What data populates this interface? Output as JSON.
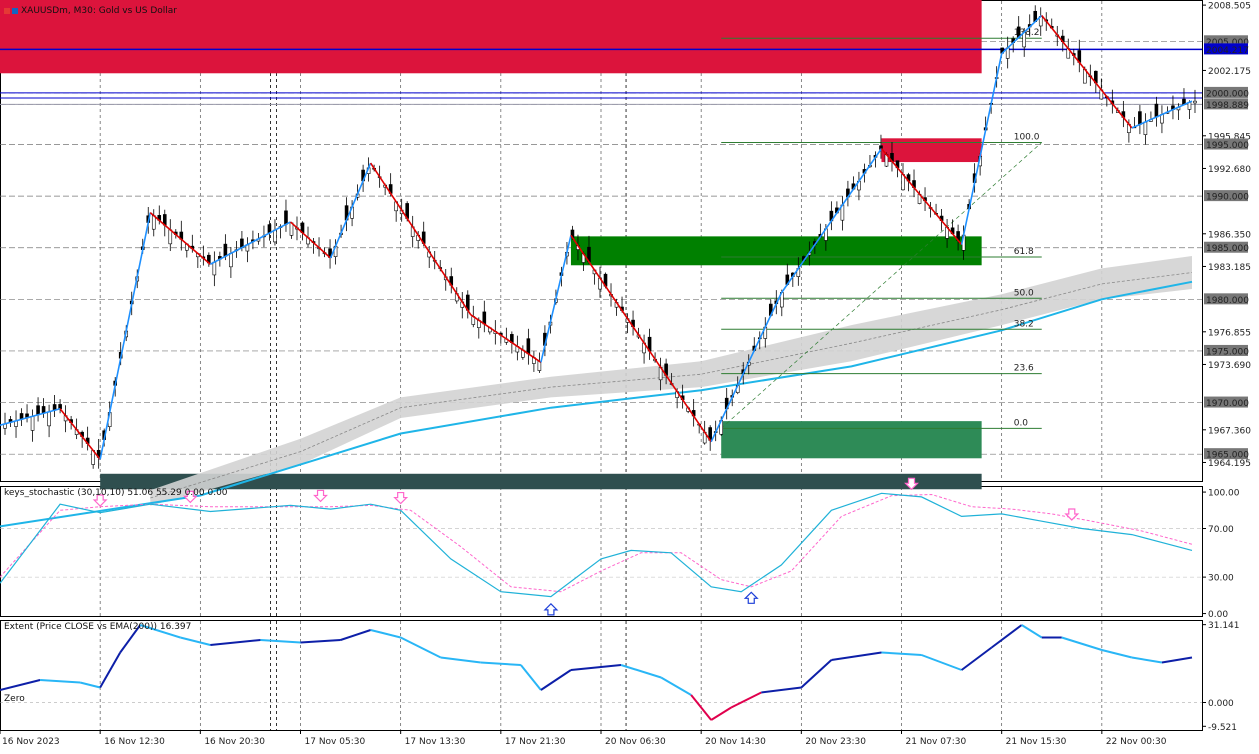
{
  "window": {
    "symbol_title": "XAUUSDm, M30:  Gold vs US Dollar"
  },
  "colors": {
    "supply_zone": "#dc143c",
    "demand_zone_dark": "#008000",
    "demand_zone_mid": "#2e8b57",
    "base_zone": "#2f4f4f",
    "up_leg": "#1e90ff",
    "down_leg": "#e00000",
    "hline_blue": "#0000cd",
    "fib_line": "#2e7d32",
    "ema_cyan": "#1fb5e8",
    "ema_band": "#d3d3d3",
    "stoch_main": "#20b2d8",
    "stoch_signal": "#ff66cc",
    "extent_light": "#29b6f6",
    "extent_dark": "#0d1fa8",
    "extent_negative": "#e0004d"
  },
  "chart_data": [
    {
      "type": "line",
      "name": "price",
      "y_ticks": [
        "2008.505",
        "2005.000",
        "2004.217",
        "2002.175",
        "2000.000",
        "1998.889",
        "1995.845",
        "1995.000",
        "1992.680",
        "1990.000",
        "1986.350",
        "1985.000",
        "1983.185",
        "1980.000",
        "1976.855",
        "1975.000",
        "1973.690",
        "1970.000",
        "1967.360",
        "1965.000",
        "1964.195"
      ],
      "y_tick_badges": [
        "2005.000",
        "2004.217",
        "2000.000",
        "1998.889",
        "1995.000",
        "1990.000",
        "1985.000",
        "1980.000",
        "1975.000",
        "1970.000",
        "1965.000"
      ],
      "ylim": [
        1962.4,
        2009.0
      ],
      "x_labels": [
        "16 Nov 2023",
        "16 Nov 12:30",
        "16 Nov 20:30",
        "17 Nov 05:30",
        "17 Nov 13:30",
        "17 Nov 21:30",
        "20 Nov 06:30",
        "20 Nov 14:30",
        "20 Nov 23:30",
        "21 Nov 07:30",
        "21 Nov 15:30",
        "22 Nov 00:30"
      ],
      "x_range": [
        0,
        120
      ],
      "zigzag": [
        [
          0,
          1967.8
        ],
        [
          6,
          1969.4
        ],
        [
          10,
          1964.5
        ],
        [
          15,
          1988.4
        ],
        [
          21,
          1983.4
        ],
        [
          29,
          1987.5
        ],
        [
          33,
          1984.0
        ],
        [
          37,
          1993.2
        ],
        [
          47,
          1978.5
        ],
        [
          54,
          1973.9
        ],
        [
          57,
          1986.2
        ],
        [
          71,
          1966.2
        ],
        [
          78,
          1980.6
        ],
        [
          88,
          1994.6
        ],
        [
          96,
          1985.3
        ],
        [
          100,
          2003.8
        ],
        [
          104,
          2007.5
        ],
        [
          113,
          1996.6
        ],
        [
          119,
          1999.2
        ]
      ],
      "ema": [
        [
          0,
          1958.0
        ],
        [
          20,
          1961.0
        ],
        [
          40,
          1967.0
        ],
        [
          55,
          1969.5
        ],
        [
          70,
          1971.2
        ],
        [
          85,
          1973.5
        ],
        [
          100,
          1977.0
        ],
        [
          110,
          1980.0
        ],
        [
          119,
          1981.7
        ]
      ],
      "ema_band_upper": [
        [
          15,
          1961.5
        ],
        [
          30,
          1966.5
        ],
        [
          40,
          1970.5
        ],
        [
          55,
          1972.5
        ],
        [
          70,
          1974.0
        ],
        [
          85,
          1977.5
        ],
        [
          100,
          1980.5
        ],
        [
          110,
          1983.0
        ],
        [
          119,
          1984.2
        ]
      ],
      "ema_band_lower": [
        [
          15,
          1960.0
        ],
        [
          30,
          1964.0
        ],
        [
          40,
          1968.5
        ],
        [
          55,
          1970.5
        ],
        [
          70,
          1971.5
        ],
        [
          85,
          1974.0
        ],
        [
          100,
          1977.5
        ],
        [
          110,
          1980.0
        ],
        [
          119,
          1981.0
        ]
      ],
      "horizontal_lines": [
        2004.217,
        2000.0,
        1999.5,
        1998.889
      ],
      "zones": [
        {
          "y1": 2009.0,
          "y2": 2001.9,
          "x1": 0,
          "x2": 98,
          "color": "supply_zone"
        },
        {
          "y1": 1995.6,
          "y2": 1993.3,
          "x1": 88,
          "x2": 98,
          "color": "supply_zone"
        },
        {
          "y1": 1986.1,
          "y2": 1983.3,
          "x1": 57,
          "x2": 98,
          "color": "demand_zone_dark"
        },
        {
          "y1": 1968.2,
          "y2": 1964.6,
          "x1": 72,
          "x2": 98,
          "color": "demand_zone_mid"
        },
        {
          "y1": 1963.1,
          "y2": 1961.6,
          "x1": 10,
          "x2": 98,
          "color": "base_zone"
        }
      ],
      "fibonacci": {
        "levels": [
          {
            "label": "138.2",
            "price": 2005.3
          },
          {
            "label": "100.0",
            "price": 1995.2
          },
          {
            "label": "61.8",
            "price": 1984.1
          },
          {
            "label": "50.0",
            "price": 1980.1
          },
          {
            "label": "38.2",
            "price": 1977.1
          },
          {
            "label": "23.6",
            "price": 1972.8
          },
          {
            "label": "0.0",
            "price": 1967.5
          }
        ],
        "x1": 72,
        "x2": 125
      }
    },
    {
      "type": "line",
      "name": "keys_stochastic",
      "title": "keys_stochastic (30,10,10) 51.06 55.29 0.00 0.00",
      "y_ticks": [
        "100.00",
        "70.00",
        "30.00",
        "0.00"
      ],
      "ylim": [
        -2,
        105
      ],
      "main": [
        [
          0,
          25
        ],
        [
          6,
          90
        ],
        [
          10,
          83
        ],
        [
          15,
          90
        ],
        [
          21,
          84
        ],
        [
          29,
          89
        ],
        [
          33,
          86
        ],
        [
          37,
          90
        ],
        [
          40,
          85
        ],
        [
          45,
          45
        ],
        [
          50,
          18
        ],
        [
          55,
          14
        ],
        [
          60,
          45
        ],
        [
          63,
          52
        ],
        [
          67,
          50
        ],
        [
          71,
          22
        ],
        [
          74,
          18
        ],
        [
          78,
          40
        ],
        [
          83,
          85
        ],
        [
          88,
          99
        ],
        [
          92,
          96
        ],
        [
          96,
          80
        ],
        [
          100,
          82
        ],
        [
          104,
          76
        ],
        [
          108,
          70
        ],
        [
          113,
          65
        ],
        [
          119,
          52
        ]
      ],
      "signal": [
        [
          0,
          30
        ],
        [
          6,
          85
        ],
        [
          10,
          88
        ],
        [
          15,
          90
        ],
        [
          21,
          88
        ],
        [
          29,
          88
        ],
        [
          33,
          88
        ],
        [
          37,
          89
        ],
        [
          41,
          85
        ],
        [
          46,
          55
        ],
        [
          51,
          22
        ],
        [
          56,
          18
        ],
        [
          60,
          35
        ],
        [
          64,
          50
        ],
        [
          68,
          50
        ],
        [
          72,
          28
        ],
        [
          75,
          22
        ],
        [
          79,
          35
        ],
        [
          84,
          80
        ],
        [
          89,
          97
        ],
        [
          93,
          98
        ],
        [
          97,
          88
        ],
        [
          101,
          86
        ],
        [
          105,
          82
        ],
        [
          109,
          76
        ],
        [
          114,
          68
        ],
        [
          119,
          57
        ]
      ],
      "arrows_down": [
        10,
        19,
        32,
        40,
        91,
        107
      ],
      "arrows_up": [
        55,
        75
      ]
    },
    {
      "type": "line",
      "name": "extent",
      "title": "Extent (Price CLOSE vs EMA(200)) 16.397",
      "y_ticks": [
        "31.141",
        "0.000",
        "-9.521"
      ],
      "ylim": [
        -11,
        33
      ],
      "zero_label": "Zero",
      "values": [
        [
          0,
          5
        ],
        [
          4,
          9
        ],
        [
          8,
          8
        ],
        [
          10,
          6
        ],
        [
          12,
          20
        ],
        [
          14,
          31
        ],
        [
          18,
          26
        ],
        [
          21,
          23
        ],
        [
          26,
          25
        ],
        [
          30,
          24
        ],
        [
          34,
          25
        ],
        [
          37,
          29
        ],
        [
          40,
          26
        ],
        [
          44,
          18
        ],
        [
          48,
          16
        ],
        [
          52,
          15
        ],
        [
          54,
          5
        ],
        [
          57,
          13
        ],
        [
          62,
          15
        ],
        [
          66,
          10
        ],
        [
          69,
          3
        ],
        [
          71,
          -7
        ],
        [
          73,
          -2
        ],
        [
          76,
          4
        ],
        [
          80,
          6
        ],
        [
          83,
          17
        ],
        [
          88,
          20
        ],
        [
          92,
          19
        ],
        [
          96,
          13
        ],
        [
          99,
          22
        ],
        [
          102,
          31
        ],
        [
          104,
          26
        ],
        [
          106,
          26
        ],
        [
          110,
          21
        ],
        [
          113,
          18
        ],
        [
          116,
          16
        ],
        [
          119,
          18
        ]
      ]
    }
  ]
}
